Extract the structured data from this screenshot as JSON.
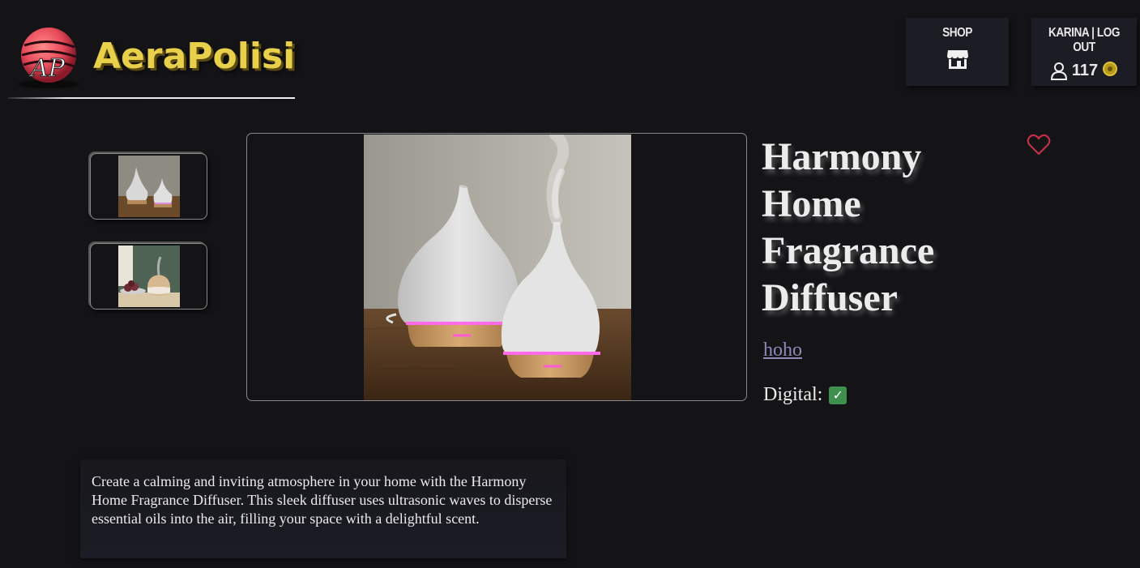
{
  "logo": {
    "text": "AeraPolisi",
    "badge": "AP"
  },
  "header": {
    "shop_label": "SHOP",
    "shop_icon": "storefront-icon",
    "user_label": "KARINA | LOG OUT",
    "user_icon": "user-icon",
    "coins": "117",
    "coin_icon": "coin-icon"
  },
  "product": {
    "title": "Harmony Home Fragrance Diffuser",
    "seller": "hoho",
    "digital_label": "Digital:",
    "digital_checked": true,
    "favorite_icon": "heart-icon",
    "description": "Create a calming and inviting atmosphere in your home with the Harmony Home Fragrance Diffuser. This sleek diffuser uses ultrasonic waves to disperse essential oils into the air, filling your space with a delightful scent."
  },
  "colors": {
    "background": "#141417",
    "logo_yellow": "#e8d04a",
    "heart": "#c0304a",
    "link": "#8e8ab8",
    "check": "#3f8f4e"
  }
}
